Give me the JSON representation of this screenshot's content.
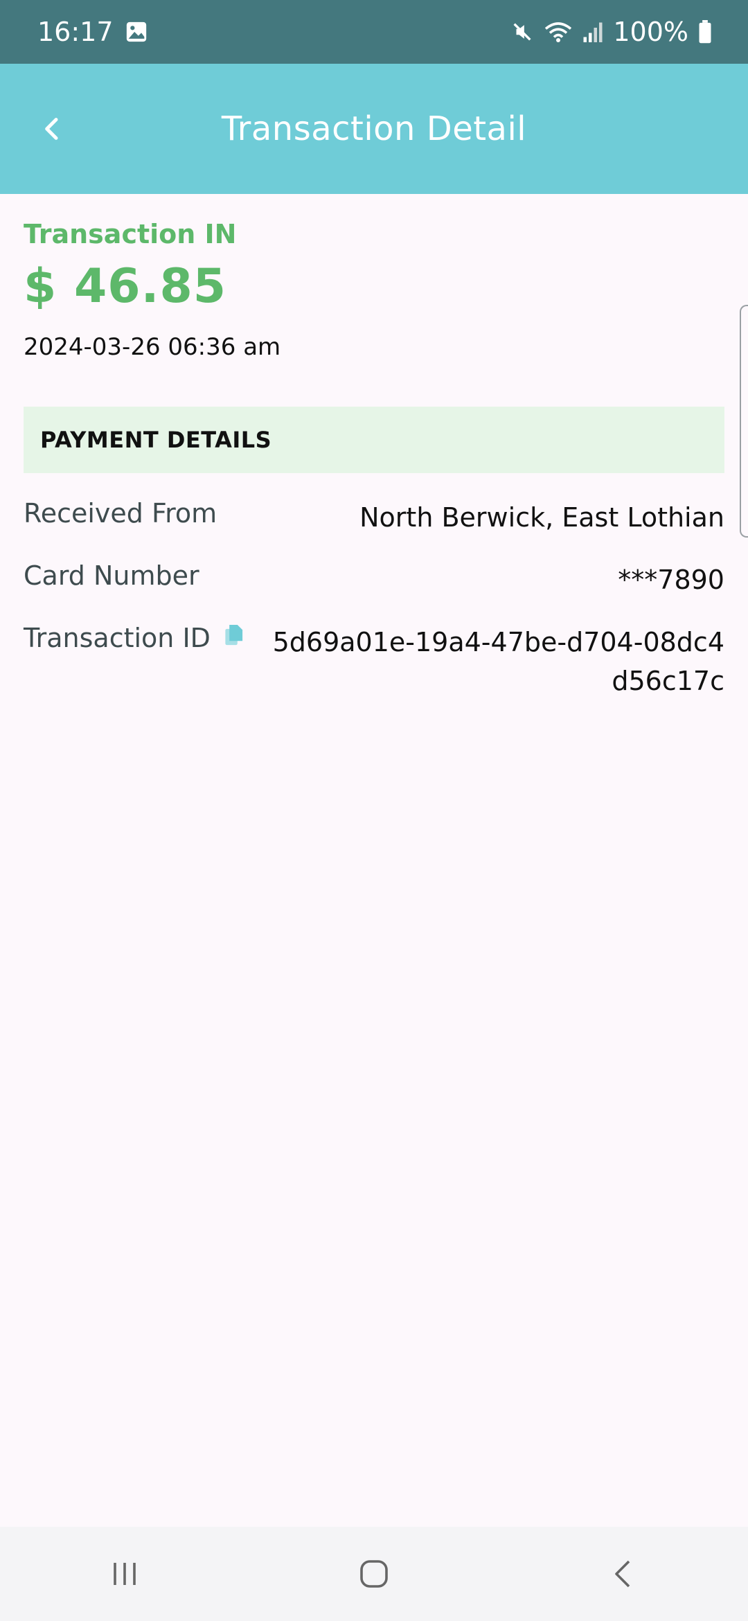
{
  "status_bar": {
    "time": "16:17",
    "battery": "100%",
    "icons": [
      "image-icon",
      "mute-icon",
      "wifi-icon",
      "signal-icon",
      "battery-icon"
    ]
  },
  "app_bar": {
    "title": "Transaction Detail",
    "back_icon": "chevron-left-icon"
  },
  "transaction": {
    "type": "Transaction IN",
    "amount": "$ 46.85",
    "date": "2024-03-26 06:36 am"
  },
  "payment_details": {
    "header": "PAYMENT DETAILS",
    "rows": [
      {
        "label": "Received From",
        "value": "North Berwick, East Lothian"
      },
      {
        "label": "Card Number",
        "value": "***7890"
      },
      {
        "label": "Transaction ID",
        "value": "5d69a01e-19a4-47be-d704-08dc4d56c17c"
      }
    ]
  },
  "nav_bar": {
    "icons": [
      "recent-apps-icon",
      "home-icon",
      "back-icon"
    ]
  },
  "colors": {
    "status_bar": "#44787e",
    "app_bar": "#6fccd7",
    "accent_green": "#5db86a",
    "section_bg": "#e6f5e7"
  }
}
